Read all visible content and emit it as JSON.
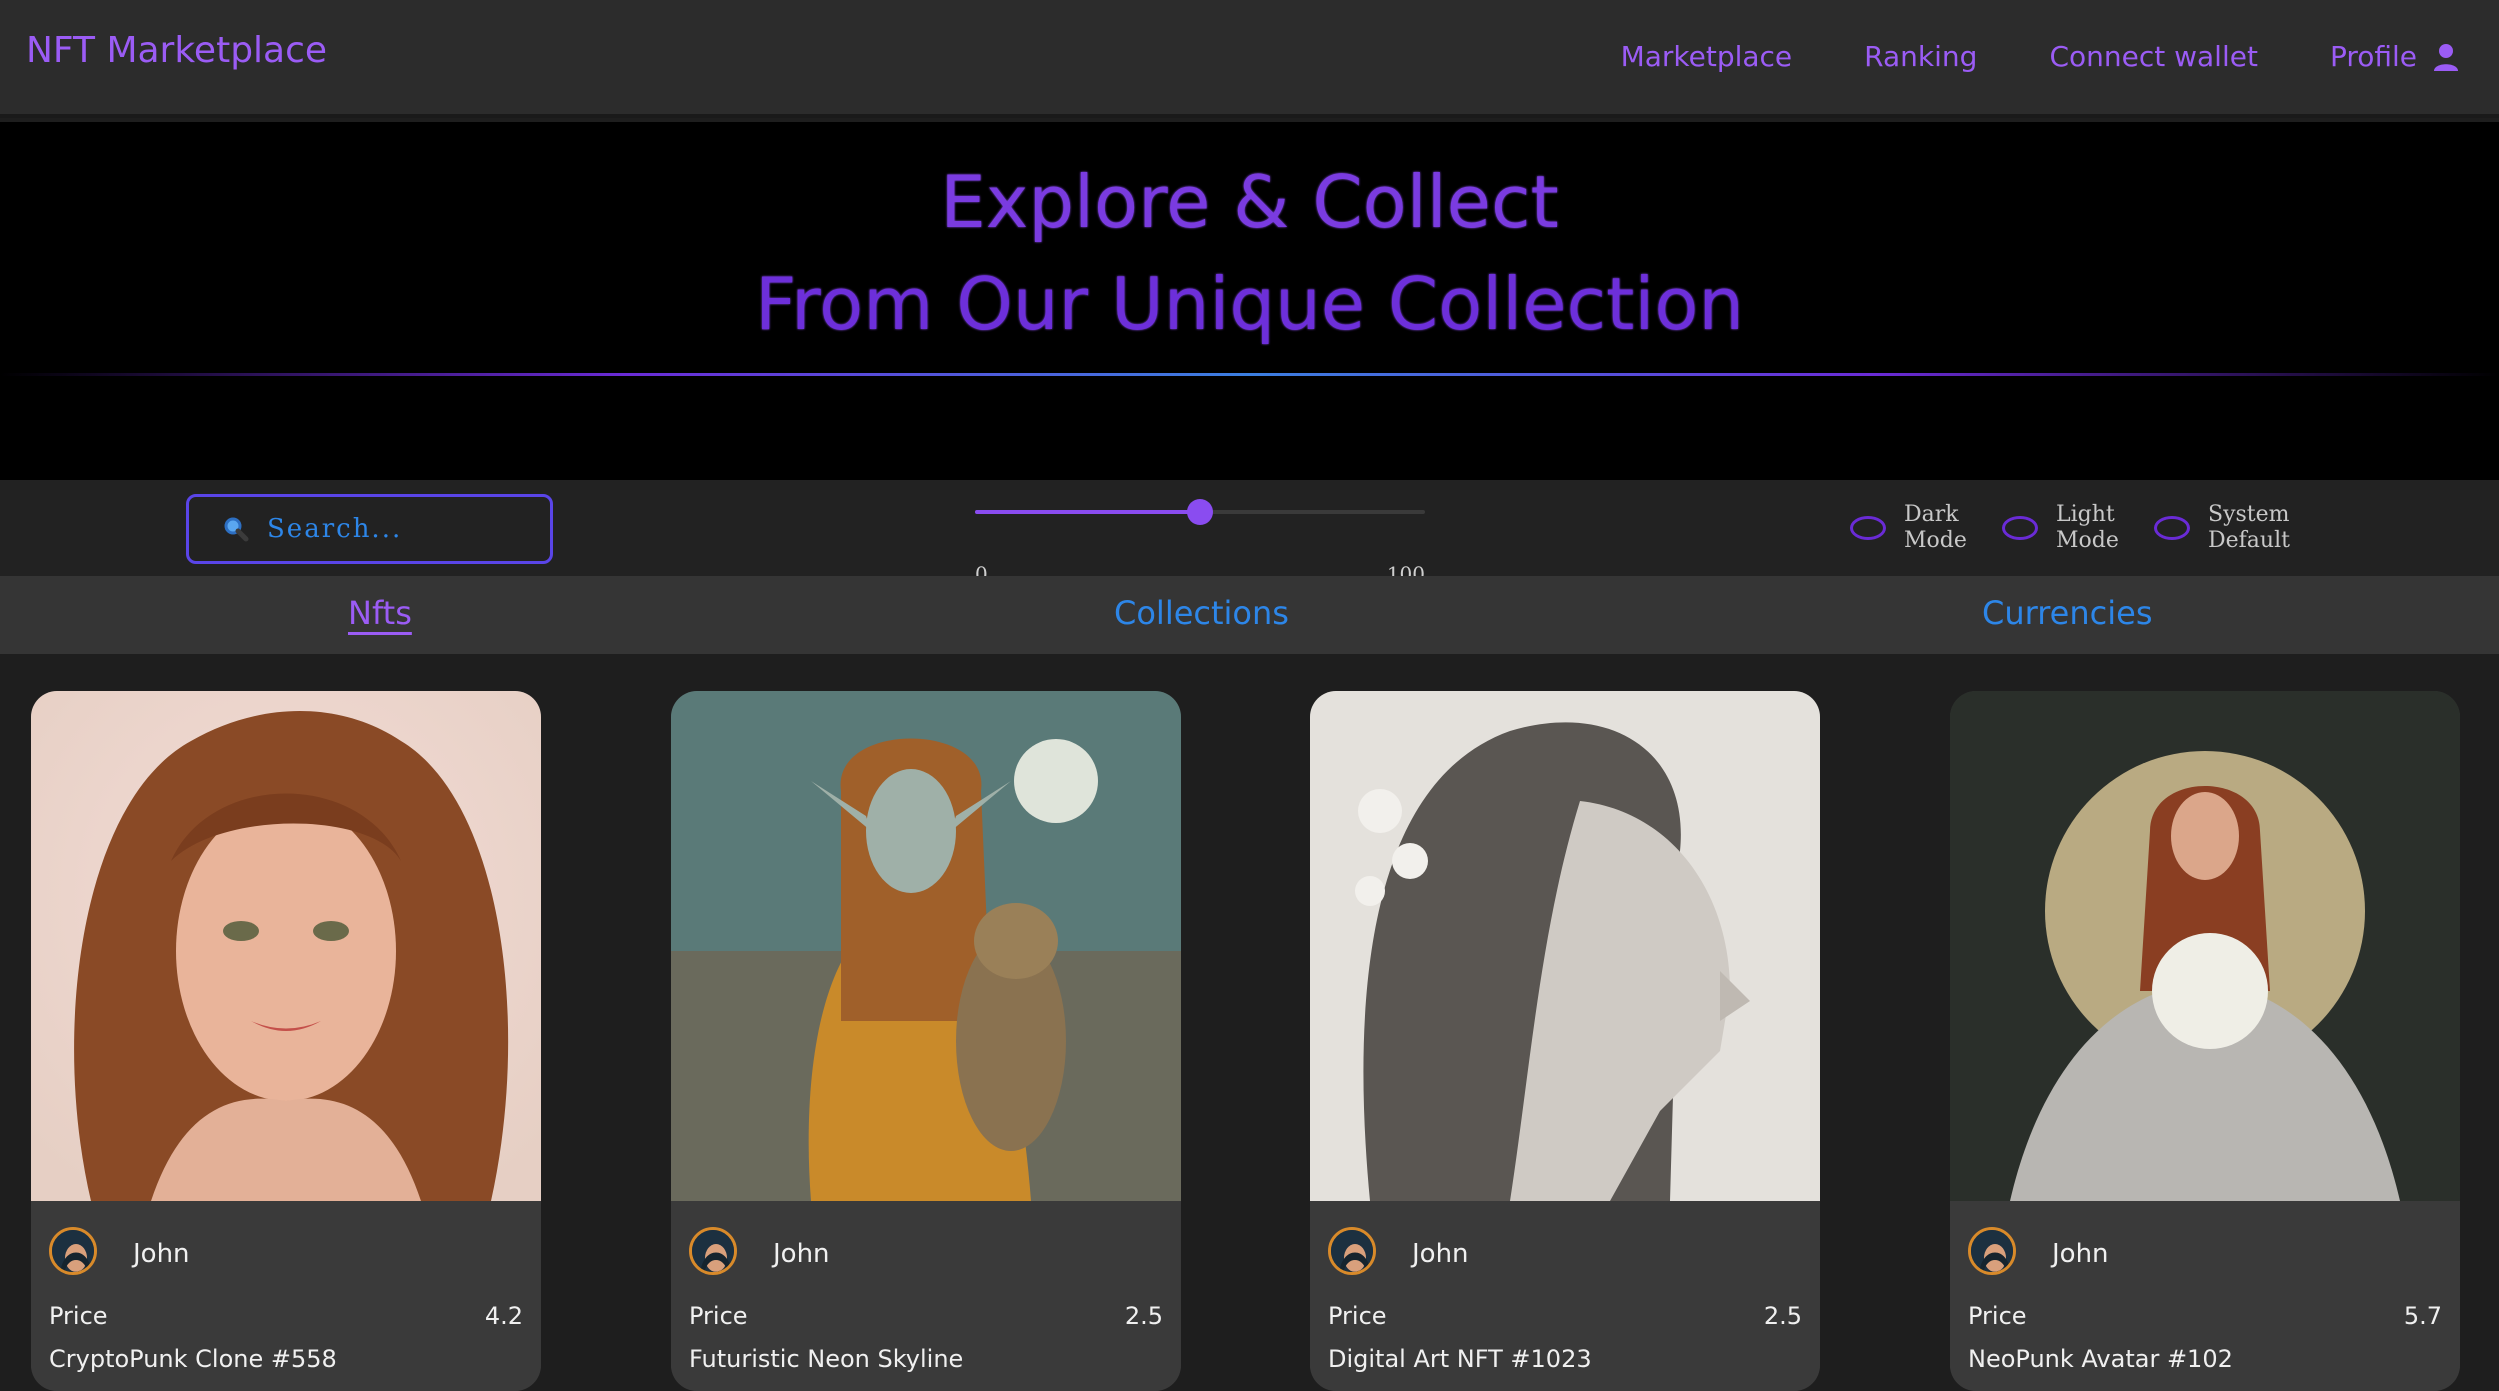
{
  "nav": {
    "brand": "NFT Marketplace",
    "links": [
      "Marketplace",
      "Ranking",
      "Connect wallet",
      "Profile"
    ]
  },
  "hero": {
    "line1": "Explore & Collect",
    "line2": "From Our Unique Collection"
  },
  "controls": {
    "search_placeholder": "Search...",
    "slider": {
      "min": "0",
      "max": "100",
      "value": 50
    },
    "modes": [
      {
        "label_line1": "Dark",
        "label_line2": "Mode"
      },
      {
        "label_line1": "Light",
        "label_line2": "Mode"
      },
      {
        "label_line1": "System",
        "label_line2": "Default"
      }
    ]
  },
  "tabs": {
    "items": [
      "Nfts",
      "Collections",
      "Currencies"
    ],
    "active": "Nfts"
  },
  "cards": [
    {
      "owner": "John",
      "price_label": "Price",
      "price": "4.2",
      "name": "CryptoPunk Clone #558"
    },
    {
      "owner": "John",
      "price_label": "Price",
      "price": "2.5",
      "name": "Futuristic Neon Skyline"
    },
    {
      "owner": "John",
      "price_label": "Price",
      "price": "2.5",
      "name": "Digital Art NFT #1023"
    },
    {
      "owner": "John",
      "price_label": "Price",
      "price": "5.7",
      "name": "NeoPunk Avatar #102"
    }
  ],
  "colors": {
    "accent": "#9b5cf5",
    "link_blue": "#2d86e8",
    "nav_bg": "#2c2c2c",
    "page_bg": "#1e1e1e"
  },
  "icons": {
    "profile": "user-icon",
    "search": "magnifier-icon"
  }
}
